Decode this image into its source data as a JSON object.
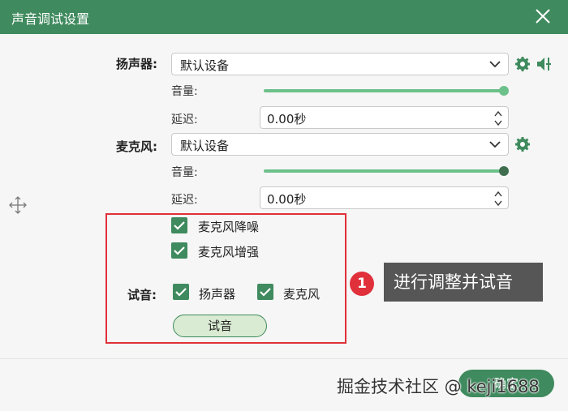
{
  "window": {
    "title": "声音调试设置"
  },
  "speaker": {
    "label": "扬声器:",
    "device": "默认设备",
    "volume_label": "音量:",
    "volume_level": 1.0,
    "delay_label": "延迟:",
    "delay_value": "0.00秒"
  },
  "microphone": {
    "label": "麦克风:",
    "device": "默认设备",
    "volume_label": "音量:",
    "volume_level": 1.0,
    "delay_label": "延迟:",
    "delay_value": "0.00秒"
  },
  "options": {
    "noise_reduction": "麦克风降噪",
    "enhance": "麦克风增强"
  },
  "test": {
    "label": "试音:",
    "speaker_check": "扬声器",
    "mic_check": "麦克风",
    "button": "试音"
  },
  "annotation": {
    "number": "1",
    "text": "进行调整并试音"
  },
  "footer": {
    "ok_button": "确定",
    "watermark": "掘金技术社区 @ keji1688"
  },
  "colors": {
    "accent": "#3f8a5e",
    "slider": "#6cc08a",
    "highlight": "#e0303a"
  },
  "icons": {
    "close": "close-icon",
    "gear": "gear-icon",
    "adjust": "speaker-adjust-icon",
    "move": "move-icon",
    "check": "checkmark-icon",
    "chevron": "chevron-down-icon"
  }
}
